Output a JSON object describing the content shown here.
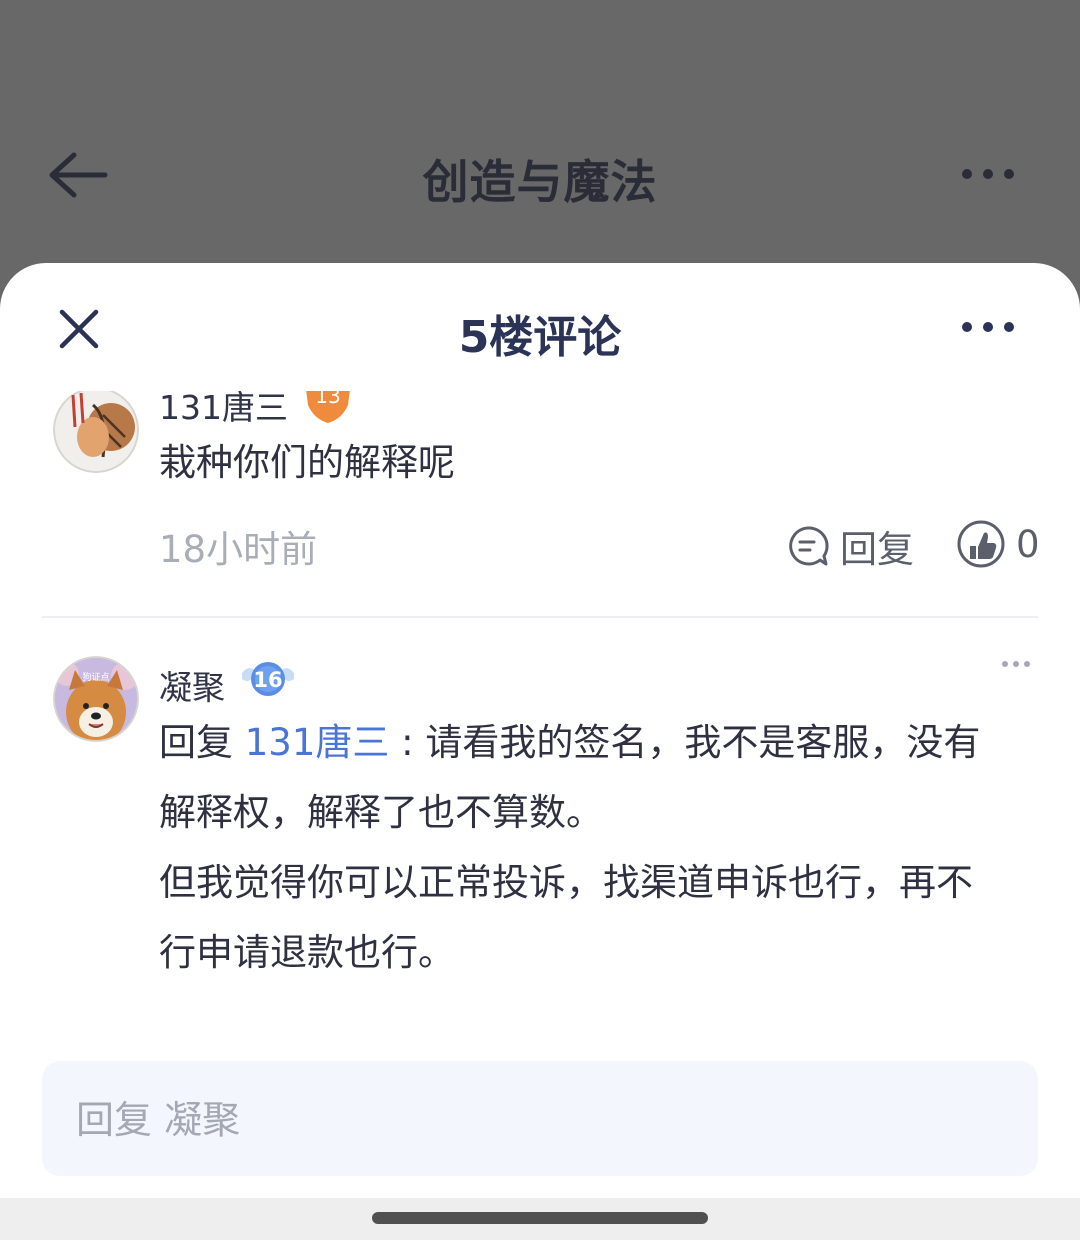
{
  "app": {
    "title": "创造与魔法"
  },
  "sheet": {
    "title": "5楼评论"
  },
  "comments": [
    {
      "username": "131唐三",
      "level": "13",
      "text": "栽种你们的解释呢",
      "time": "18小时前",
      "reply_label": "回复",
      "like_count": "0"
    },
    {
      "username": "凝聚",
      "level": "16",
      "reply_prefix": "回复",
      "reply_target": "131唐三",
      "separator": ":",
      "line1": "请看我的签名，我不是客服，没有",
      "line2": "解释权，解释了也不算数。",
      "line3": "但我觉得你可以正常投诉，找渠道申诉也行，再不",
      "line4": "行申请退款也行。",
      "avatar_text": "狗证点"
    }
  ],
  "reply_input": {
    "placeholder": "回复 凝聚",
    "value": ""
  },
  "colors": {
    "accent": "#4a74d6",
    "title": "#2b3357",
    "dim_overlay": "#686868"
  },
  "icons": [
    "back-arrow-icon",
    "more-icon",
    "close-icon",
    "comment-icon",
    "thumbs-up-icon",
    "level-badge-icon"
  ]
}
